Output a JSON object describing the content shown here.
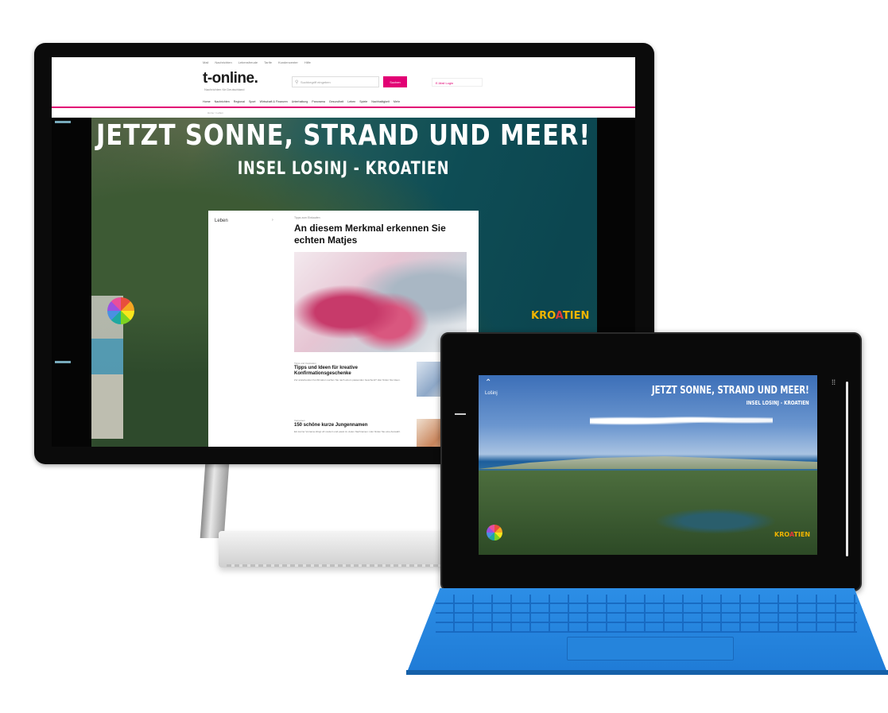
{
  "website": {
    "topnav": [
      "Mail",
      "Nachrichten",
      "Lebensfreude",
      "Tarife",
      "Kundencenter",
      "Hilfe"
    ],
    "logo": "t-online.",
    "logo_tagline": "Nachrichten für Deutschland",
    "search_placeholder": "Suchbegriff eingeben",
    "search_button": "Suchen",
    "login_label": "E-Mail Login",
    "categories": [
      "Home",
      "Nachrichten",
      "Regional",
      "Sport",
      "Wirtschaft & Finanzen",
      "Unterhaltung",
      "Panorama",
      "Gesundheit",
      "Leben",
      "Spiele",
      "Nachhaltigkeit",
      "Mehr"
    ],
    "breadcrumb": "Home > Leben",
    "brand_color": "#e20074"
  },
  "ad": {
    "title": "JETZT SONNE, STRAND UND MEER!",
    "subtitle": "INSEL LOSINJ - KROATIEN",
    "brand_left": "Lošinj",
    "brand_right": [
      "KRO",
      "A",
      "TIEN"
    ]
  },
  "article": {
    "section": "Leben",
    "kicker": "Tipps zum Einkaufen",
    "headline": "An diesem Merkmal erkennen Sie echten Matjes",
    "items": [
      {
        "kicker": "Tipps und Inspiration",
        "title": "Tipps und Ideen für kreative Konfirmationsgeschenke",
        "text": "Zur anstehenden Konfirmation suchen Sie nach einem passenden Geschenk? Hier finden Sie Ideen."
      },
      {
        "kicker": "Vornamen",
        "title": "150 schöne kurze Jungennamen",
        "text": "Ein kurzer Vorname klingt oft modern und passt zu vielen Nachnamen. Hier finden Sie eine Auswahl."
      }
    ]
  },
  "tablet": {
    "title": "JETZT SONNE, STRAND UND MEER!",
    "subtitle": "INSEL LOSINJ - KROATIEN",
    "brand": "Lošinj",
    "brand_right": [
      "KRO",
      "A",
      "TIEN"
    ]
  },
  "icons": {
    "search": "search-icon",
    "cart": "cart-icon",
    "grid": "grid-icon"
  },
  "colors": {
    "keyboard": "#2c8ee6",
    "ad_sea": "#0e4d55"
  }
}
